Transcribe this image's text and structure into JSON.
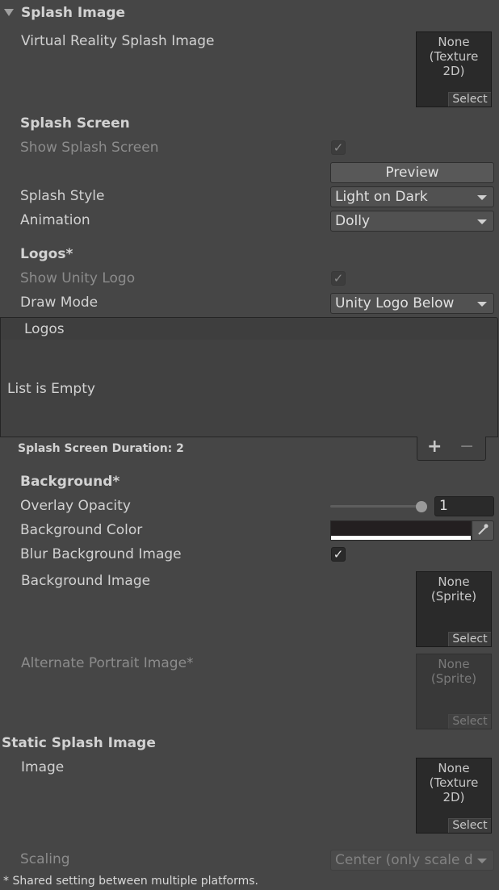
{
  "splash_image": {
    "header": "Splash Image",
    "vr_label": "Virtual Reality Splash Image",
    "vr_field": {
      "value": "None\n(Texture 2D)",
      "select": "Select"
    }
  },
  "splash_screen": {
    "header": "Splash Screen",
    "show_label": "Show Splash Screen",
    "show_checked": true,
    "preview_button": "Preview",
    "style_label": "Splash Style",
    "style_value": "Light on Dark",
    "animation_label": "Animation",
    "animation_value": "Dolly"
  },
  "logos": {
    "header": "Logos*",
    "show_unity_logo_label": "Show Unity Logo",
    "draw_mode_label": "Draw Mode",
    "draw_mode_value": "Unity Logo Below",
    "list_header": "Logos",
    "empty_text": "List is Empty",
    "duration_label": "Splash Screen Duration: 2",
    "add_label": "+",
    "remove_label": "−"
  },
  "background": {
    "header": "Background*",
    "overlay_label": "Overlay Opacity",
    "overlay_value": "1",
    "overlay_fraction": 1.0,
    "color_label": "Background Color",
    "color_hex": "#231f20",
    "blur_label": "Blur Background Image",
    "blur_checked": true,
    "image_label": "Background Image",
    "image_field": {
      "value": "None\n(Sprite)",
      "select": "Select"
    },
    "portrait_label": "Alternate Portrait Image*",
    "portrait_field": {
      "value": "None\n(Sprite)",
      "select": "Select"
    }
  },
  "static_splash": {
    "header": "Static Splash Image",
    "image_label": "Image",
    "image_field": {
      "value": "None\n(Texture 2D)",
      "select": "Select"
    },
    "scaling_label": "Scaling",
    "scaling_value": "Center (only scale d"
  },
  "footnote": "* Shared setting between multiple platforms.",
  "icons": {
    "check": "✓",
    "eyedropper": "eyedropper-icon",
    "foldout": "foldout-arrow-icon"
  }
}
